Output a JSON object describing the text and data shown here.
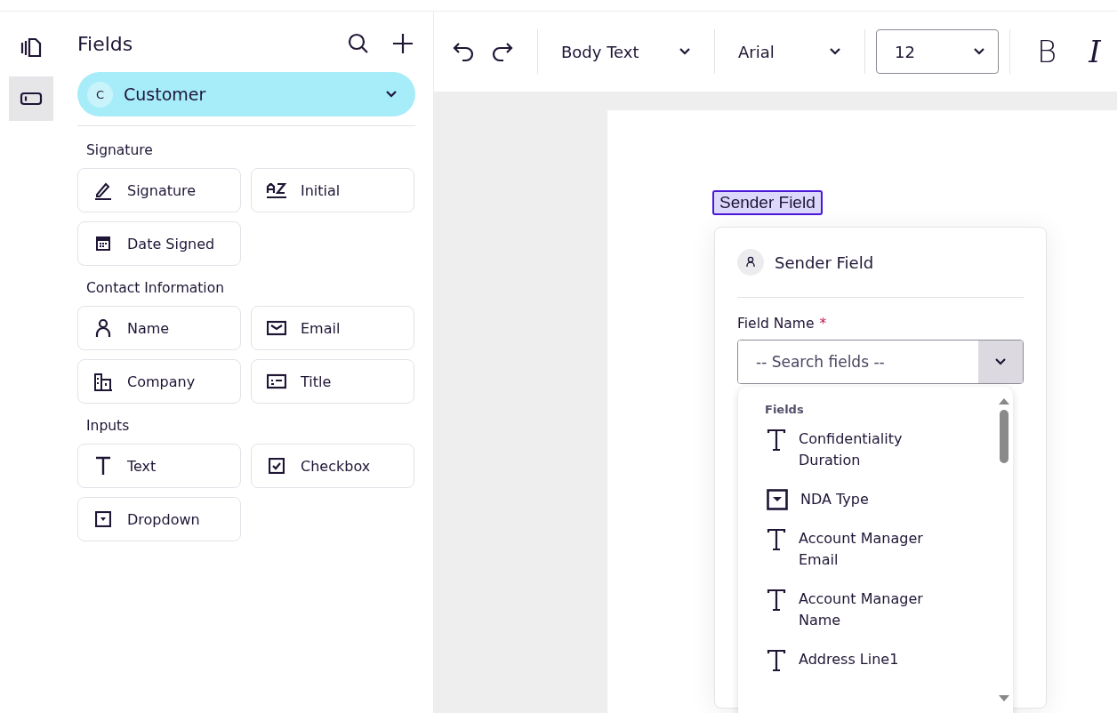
{
  "rail": [
    {
      "kind": "pages",
      "selected": false
    },
    {
      "kind": "field",
      "selected": true
    }
  ],
  "panel": {
    "title": "Fields",
    "recipient": {
      "initial": "C",
      "name": "Customer"
    },
    "groups": [
      {
        "title": "Signature",
        "items": [
          {
            "kind": "pen",
            "label": "Signature"
          },
          {
            "kind": "az",
            "label": "Initial"
          },
          {
            "kind": "calendar",
            "label": "Date Signed"
          }
        ]
      },
      {
        "title": "Contact Information",
        "items": [
          {
            "kind": "person",
            "label": "Name"
          },
          {
            "kind": "mail",
            "label": "Email"
          },
          {
            "kind": "building",
            "label": "Company"
          },
          {
            "kind": "idcard",
            "label": "Title"
          }
        ]
      },
      {
        "title": "Inputs",
        "items": [
          {
            "kind": "text",
            "label": "Text"
          },
          {
            "kind": "checkbox",
            "label": "Checkbox"
          },
          {
            "kind": "dropdown",
            "label": "Dropdown"
          }
        ]
      }
    ]
  },
  "toolbar": {
    "style": "Body Text",
    "font": "Arial",
    "size": "12",
    "bold": "B",
    "italic": "I"
  },
  "document": {
    "tag": "Sender Field",
    "popover": {
      "title": "Sender Field",
      "field_label": "Field Name",
      "required_mark": "*",
      "placeholder": "-- Search fields --",
      "list": {
        "heading": "Fields",
        "items": [
          {
            "kind": "text",
            "label": "Confidentiality Duration"
          },
          {
            "kind": "dropdown",
            "label": "NDA Type"
          },
          {
            "kind": "text",
            "label": "Account Manager Email"
          },
          {
            "kind": "text",
            "label": "Account Manager Name"
          },
          {
            "kind": "text",
            "label": "Address Line1"
          }
        ]
      }
    }
  }
}
